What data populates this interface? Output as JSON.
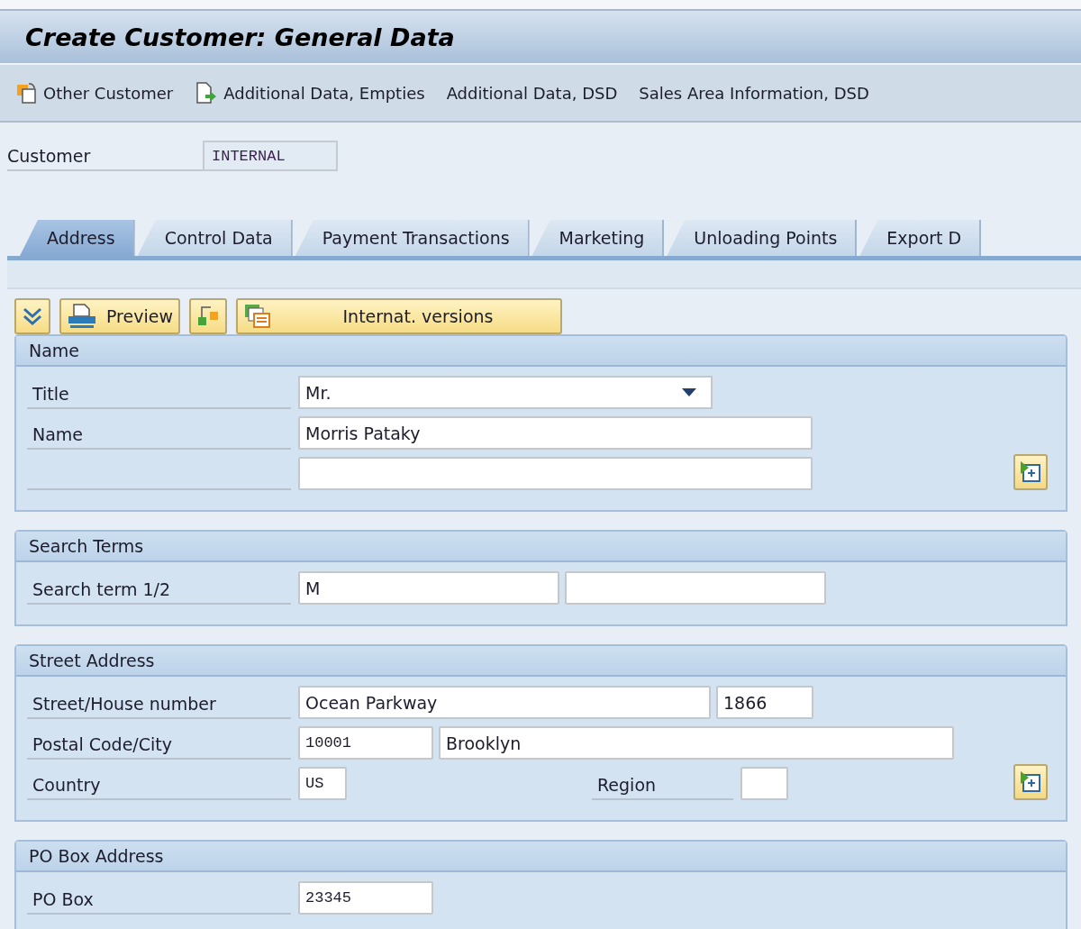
{
  "window": {
    "title": "Create Customer: General Data"
  },
  "toolbar": [
    {
      "label": "Other Customer"
    },
    {
      "label": "Additional Data, Empties"
    },
    {
      "label": "Additional Data, DSD"
    },
    {
      "label": "Sales Area Information, DSD"
    }
  ],
  "customer": {
    "label": "Customer",
    "value": "INTERNAL"
  },
  "tabs": [
    {
      "label": "Address",
      "selected": true
    },
    {
      "label": "Control Data",
      "selected": false
    },
    {
      "label": "Payment Transactions",
      "selected": false
    },
    {
      "label": "Marketing",
      "selected": false
    },
    {
      "label": "Unloading Points",
      "selected": false
    },
    {
      "label": "Export D",
      "selected": false
    }
  ],
  "buttons": [
    {
      "kind": "expand"
    },
    {
      "kind": "preview",
      "label": "Preview"
    },
    {
      "kind": "hierarchy"
    },
    {
      "kind": "versions",
      "label": "Internat. versions"
    }
  ],
  "panels": [
    {
      "title": "Name",
      "more_button": true,
      "rows": [
        {
          "label": "Title",
          "fields": [
            {
              "kind": "combo",
              "value": "Mr."
            }
          ]
        },
        {
          "label": "Name",
          "fields": [
            {
              "kind": "text",
              "value": "Morris Pataky"
            }
          ]
        },
        {
          "fields": [
            {
              "kind": "text"
            }
          ]
        }
      ]
    },
    {
      "title": "Search Terms",
      "more_button": false,
      "rows": [
        {
          "label": "Search term 1/2",
          "fields": [
            {
              "kind": "text",
              "value": "M"
            },
            {
              "kind": "text"
            }
          ]
        }
      ]
    },
    {
      "title": "Street Address",
      "more_button": true,
      "rows": [
        {
          "label": "Street/House number",
          "fields": [
            {
              "kind": "text",
              "value": "Ocean Parkway"
            },
            {
              "kind": "text",
              "value": "1866"
            }
          ]
        },
        {
          "label": "Postal Code/City",
          "fields": [
            {
              "kind": "mono",
              "value": "10001"
            },
            {
              "kind": "text",
              "value": "Brooklyn"
            }
          ]
        },
        {
          "label": "Country",
          "fields": [
            {
              "kind": "mono",
              "value": "US"
            }
          ],
          "side": {
            "label": "Region",
            "field": {
              "kind": "text"
            }
          }
        }
      ]
    },
    {
      "title": "PO Box Address",
      "more_button": false,
      "rows": [
        {
          "label": "PO Box",
          "fields": [
            {
              "kind": "mono",
              "value": "23345"
            }
          ]
        }
      ]
    }
  ]
}
